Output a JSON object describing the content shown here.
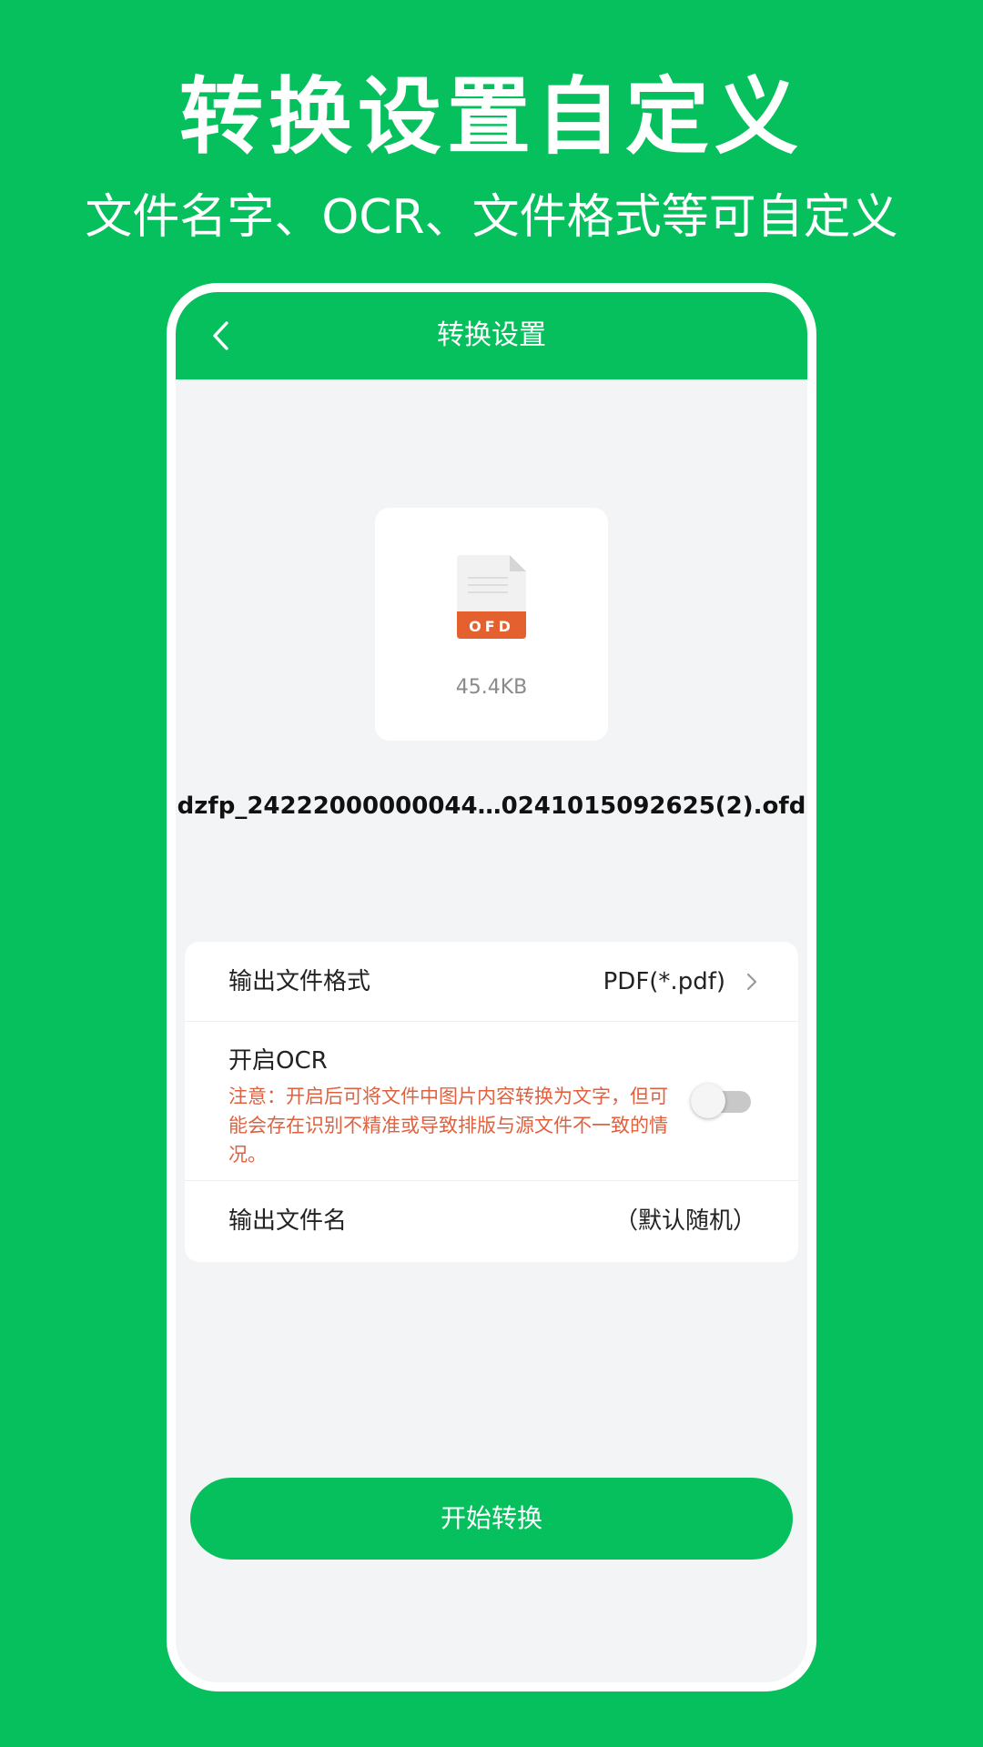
{
  "promo": {
    "title": "转换设置自定义",
    "subtitle": "文件名字、OCR、文件格式等可自定义"
  },
  "header": {
    "title": "转换设置",
    "back_icon": "chevron-left-icon"
  },
  "file": {
    "badge": "OFD",
    "size": "45.4KB",
    "name": "dzfp_24222000000044…0241015092625(2).ofd"
  },
  "settings": {
    "format": {
      "label": "输出文件格式",
      "value": "PDF(*.pdf)"
    },
    "ocr": {
      "label": "开启OCR",
      "note": "注意：开启后可将文件中图片内容转换为文字，但可能会存在识别不精准或导致排版与源文件不一致的情况。",
      "enabled": false
    },
    "filename": {
      "label": "输出文件名",
      "value": "（默认随机）"
    }
  },
  "actions": {
    "start_label": "开始转换"
  },
  "colors": {
    "brand_green": "#06C05E",
    "ofd_orange": "#E4612F",
    "warning_text": "#E0613F"
  }
}
